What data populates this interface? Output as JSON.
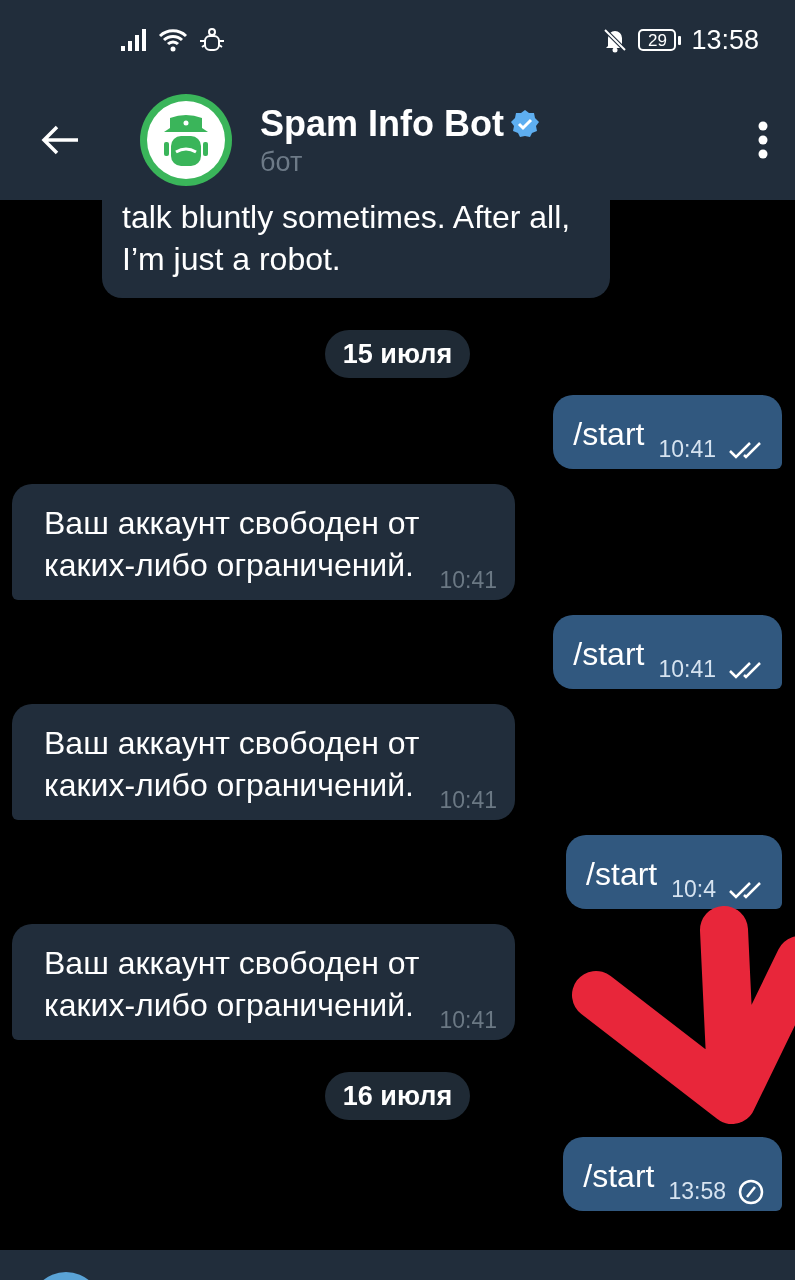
{
  "status_bar": {
    "battery": "29",
    "time": "13:58"
  },
  "header": {
    "title": "Spam Info Bot",
    "verified": true,
    "subtitle": "бот"
  },
  "chat": [
    {
      "kind": "incoming",
      "text": "talk bluntly sometimes. After all,\nI’m just a robot."
    },
    {
      "kind": "date",
      "text": "15 июля"
    },
    {
      "kind": "outgoing",
      "text": "/start",
      "time": "10:41",
      "sent": true,
      "read": true
    },
    {
      "kind": "incoming",
      "text": "Ваш аккаунт свободен от\nкаких-либо ограничений.",
      "time": "10:41"
    },
    {
      "kind": "outgoing",
      "text": "/start",
      "time": "10:41",
      "sent": true,
      "read": true
    },
    {
      "kind": "incoming",
      "text": "Ваш аккаунт свободен от\nкаких-либо ограничений.",
      "time": "10:41"
    },
    {
      "kind": "outgoing",
      "text": "/start",
      "time": "10:4",
      "sent": true,
      "read": true
    },
    {
      "kind": "incoming",
      "text": "Ваш аккаунт свободен от\nкаких-либо ограничений.",
      "time": "10:41"
    },
    {
      "kind": "date",
      "text": "16 июля"
    },
    {
      "kind": "outgoing",
      "text": "/start",
      "time": "13:58",
      "sent": false
    }
  ]
}
